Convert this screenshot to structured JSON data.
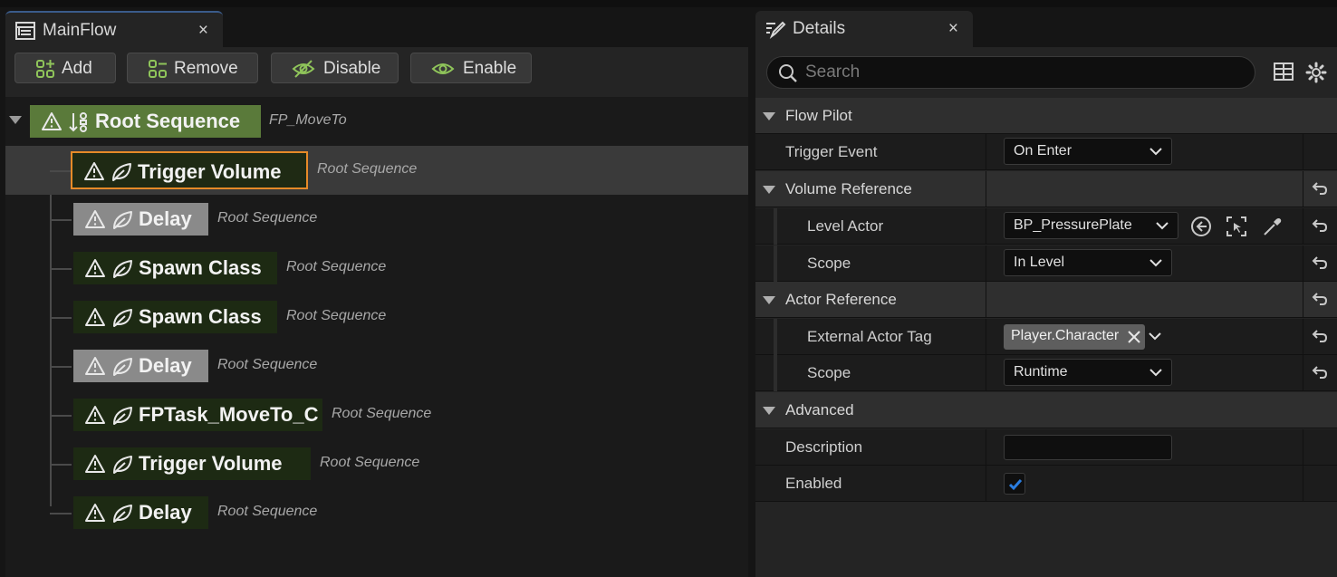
{
  "left_tab": {
    "title": "MainFlow",
    "close": "×"
  },
  "right_tab": {
    "title": "Details",
    "close": "×"
  },
  "toolbar": {
    "add_label": "Add",
    "remove_label": "Remove",
    "disable_label": "Disable",
    "enable_label": "Enable"
  },
  "tree": {
    "root": {
      "label": "Root Sequence",
      "owner": "FP_MoveTo",
      "icons": [
        "warning-icon",
        "sort-icon"
      ]
    },
    "nodes": [
      {
        "label": "Trigger Volume",
        "owner": "Root Sequence",
        "selected": true,
        "disabled": false
      },
      {
        "label": "Delay",
        "owner": "Root Sequence",
        "selected": false,
        "disabled": true
      },
      {
        "label": "Spawn Class",
        "owner": "Root Sequence",
        "selected": false,
        "disabled": false
      },
      {
        "label": "Spawn Class",
        "owner": "Root Sequence",
        "selected": false,
        "disabled": false
      },
      {
        "label": "Delay",
        "owner": "Root Sequence",
        "selected": false,
        "disabled": true
      },
      {
        "label": "FPTask_MoveTo_C",
        "owner": "Root Sequence",
        "selected": false,
        "disabled": false
      },
      {
        "label": "Trigger Volume",
        "owner": "Root Sequence",
        "selected": false,
        "disabled": false
      },
      {
        "label": "Delay",
        "owner": "Root Sequence",
        "selected": false,
        "disabled": false
      }
    ]
  },
  "details": {
    "search_placeholder": "Search",
    "sections": {
      "flow_pilot": "Flow Pilot",
      "volume_reference": "Volume Reference",
      "actor_reference": "Actor Reference",
      "advanced": "Advanced"
    },
    "trigger_event": {
      "label": "Trigger Event",
      "value": "On Enter"
    },
    "level_actor": {
      "label": "Level Actor",
      "value": "BP_PressurePlate"
    },
    "volume_scope": {
      "label": "Scope",
      "value": "In Level"
    },
    "external_actor_tag": {
      "label": "External Actor Tag",
      "value": "Player.Character"
    },
    "actor_scope": {
      "label": "Scope",
      "value": "Runtime"
    },
    "description": {
      "label": "Description",
      "value": ""
    },
    "enabled": {
      "label": "Enabled",
      "checked": true
    }
  },
  "colors": {
    "root_node": "#5a7a3a",
    "task_node": "#1d2a13",
    "disabled_node": "#8a8a8a",
    "selection_border": "#e68a28",
    "checkbox_check": "#2a7de0",
    "icon_green": "#8fc45a"
  }
}
